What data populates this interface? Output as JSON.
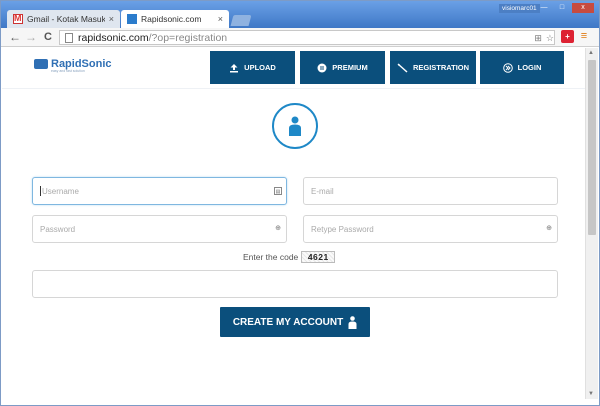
{
  "browser": {
    "user_label": "visiomarc01",
    "tabs": [
      {
        "title": "Gmail - Kotak Masuk",
        "close": "×"
      },
      {
        "title": "Rapidsonic.com",
        "close": "×"
      }
    ],
    "window_buttons": {
      "minimize": "—",
      "maximize": "□",
      "close": "x"
    },
    "url_host": "rapidsonic.com",
    "url_path": "/?op=registration"
  },
  "site": {
    "logo_text": "RapidSonic",
    "logo_tagline": "easy and fast solution",
    "nav": [
      {
        "label": "UPLOAD",
        "icon": "upload-icon"
      },
      {
        "label": "PREMIUM",
        "icon": "premium-icon"
      },
      {
        "label": "REGISTRATION",
        "icon": "wand-icon"
      },
      {
        "label": "LOGIN",
        "icon": "login-icon"
      }
    ],
    "accent_color": "#0b4f7c",
    "avatar_color": "#1e88c7"
  },
  "form": {
    "username_placeholder": "Username",
    "email_placeholder": "E-mail",
    "password_placeholder": "Password",
    "retype_placeholder": "Retype Password",
    "code_label": "Enter the code",
    "captcha_value": "4621",
    "code_value": "",
    "submit_label": "CREATE MY ACCOUNT"
  }
}
